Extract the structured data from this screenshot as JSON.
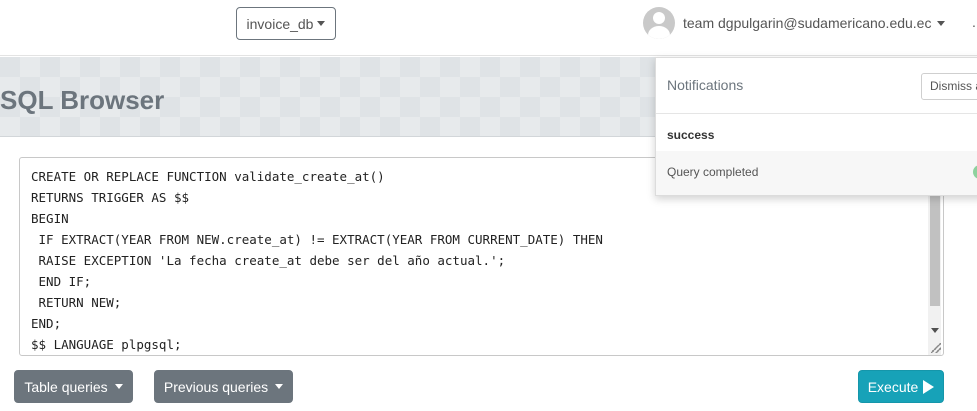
{
  "navbar": {
    "database_selector": "invoice_db",
    "user_label": "team dgpulgarin@sudamericano.edu.ec",
    "overflow_mark": "."
  },
  "page": {
    "title": "SQL Browser"
  },
  "editor": {
    "code": "CREATE OR REPLACE FUNCTION validate_create_at()\nRETURNS TRIGGER AS $$\nBEGIN\n IF EXTRACT(YEAR FROM NEW.create_at) != EXTRACT(YEAR FROM CURRENT_DATE) THEN\n RAISE EXCEPTION 'La fecha create_at debe ser del año actual.';\n END IF;\n RETURN NEW;\nEND;\n$$ LANGUAGE plpgsql;"
  },
  "actions": {
    "table_queries_label": "Table queries",
    "previous_queries_label": "Previous queries",
    "execute_label": "Execute"
  },
  "notifications": {
    "title": "Notifications",
    "dismiss_label": "Dismiss all",
    "status": "success",
    "message": "Query completed",
    "status_color": "#8fd19e"
  },
  "colors": {
    "secondary": "#6c757d",
    "info": "#17a2b8"
  }
}
